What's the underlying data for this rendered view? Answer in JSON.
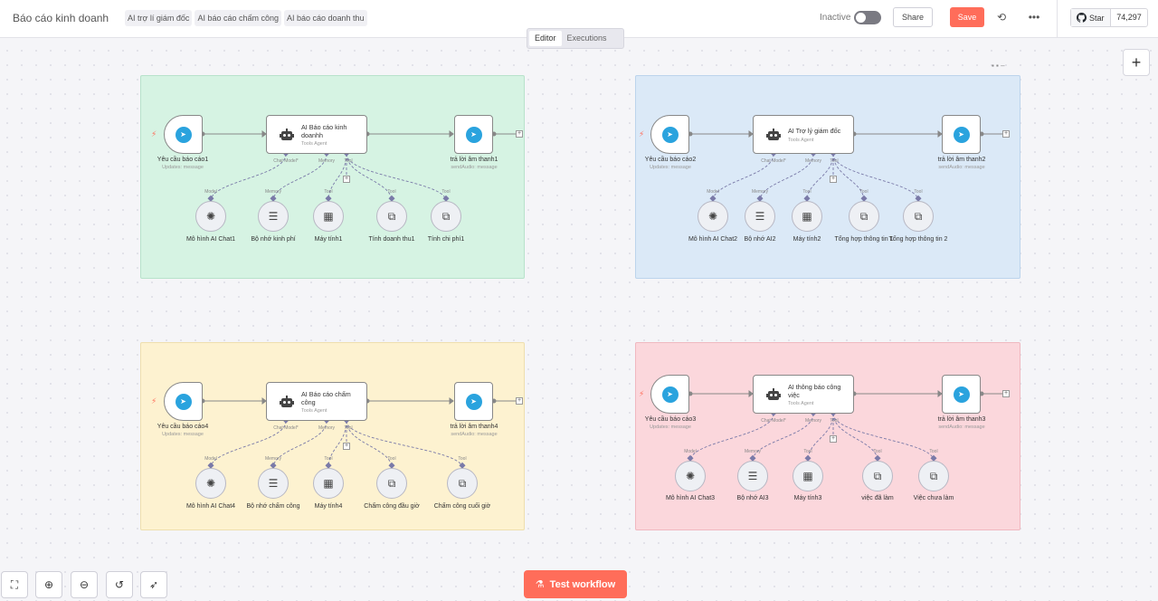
{
  "header": {
    "workflow_name": "Báo cáo kinh doanh",
    "tags": [
      "AI trợ lí giám đốc",
      "AI báo cáo chấm công",
      "AI báo cáo doanh thu"
    ],
    "inactive_label": "Inactive",
    "share_label": "Share",
    "save_label": "Save",
    "github_star_label": "Star",
    "github_star_count": "74,297"
  },
  "tabs": [
    {
      "label": "Editor",
      "active": true
    },
    {
      "label": "Executions",
      "active": false
    }
  ],
  "colors": {
    "accent": "#ff6d5a",
    "telegram": "#2aa3de",
    "green": "#d6f3e3",
    "blue": "#dbe9f7",
    "yellow": "#fdf2d0",
    "pink": "#fbd7dc"
  },
  "port_labels": {
    "chat_model": "Chat Model*",
    "memory": "Memory",
    "tool": "Tool",
    "model": "Model"
  },
  "groups": [
    {
      "trigger": {
        "name": "Yêu cầu báo cáo1",
        "sub": "Updates: message"
      },
      "agent": {
        "name": "AI Báo cáo kinh doanhh",
        "sub": "Tools Agent"
      },
      "output": {
        "name": "trả lời âm thanh1",
        "sub": "sendAudio: message"
      },
      "subnodes": [
        "Mô hình AI Chat1",
        "Bộ nhớ kinh phí",
        "Máy tính1",
        "Tính doanh thu1",
        "Tính chi phí1"
      ]
    },
    {
      "trigger": {
        "name": "Yêu cầu báo cáo2",
        "sub": "Updates: message"
      },
      "agent": {
        "name": "AI Trợ lý giám đốc",
        "sub": "Tools Agent"
      },
      "output": {
        "name": "trả lời âm thanh2",
        "sub": "sendAudio: message"
      },
      "subnodes": [
        "Mô hình AI Chat2",
        "Bộ nhớ AI2",
        "Máy tính2",
        "Tổng hợp thông tin 1",
        "Tổng hợp thông tin 2"
      ]
    },
    {
      "trigger": {
        "name": "Yêu cầu báo cáo4",
        "sub": "Updates: message"
      },
      "agent": {
        "name": "AI Báo cáo chấm công",
        "sub": "Tools Agent"
      },
      "output": {
        "name": "trả lời âm thanh4",
        "sub": "sendAudio: message"
      },
      "subnodes": [
        "Mô hình AI Chat4",
        "Bộ nhớ chấm công",
        "Máy tính4",
        "Chấm công đầu giờ",
        "Chấm công cuối giờ"
      ]
    },
    {
      "trigger": {
        "name": "Yêu cầu báo cáo3",
        "sub": "Updates: message"
      },
      "agent": {
        "name": "AI thông báo công việc",
        "sub": "Tools Agent"
      },
      "output": {
        "name": "trả lời âm thanh3",
        "sub": "sendAudio: message"
      },
      "subnodes": [
        "Mô hình AI Chat3",
        "Bộ nhớ AI3",
        "Máy tính3",
        "việc đã làm",
        "Việc chưa làm"
      ]
    }
  ],
  "icons": {
    "subnode_icons": [
      "openai-icon",
      "database-icon",
      "calculator-icon",
      "workflow-icon",
      "workflow-icon"
    ]
  },
  "bottom": {
    "test_workflow_label": "Test workflow"
  }
}
